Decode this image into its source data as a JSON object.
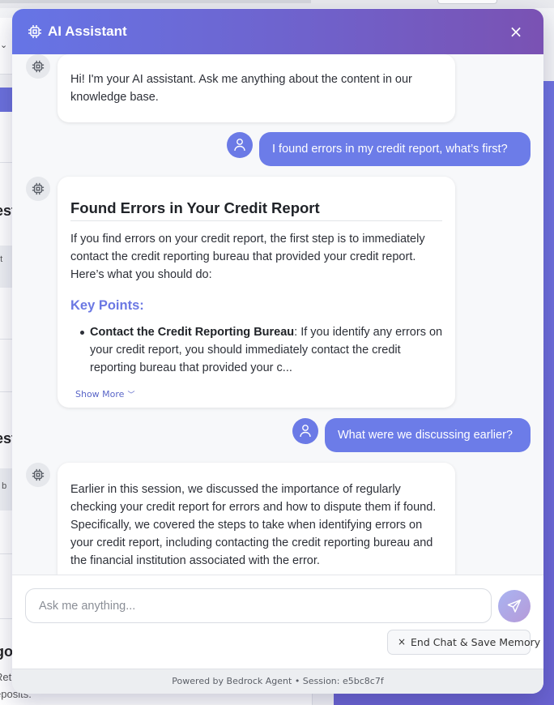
{
  "background": {
    "fragment_1": "est",
    "fragment_2": "nt",
    "fragment_3": "est",
    "fragment_4": "t b",
    "fragment_5": "go",
    "fragment_6": "Ret",
    "fragment_7": "eposits."
  },
  "header": {
    "title": "AI Assistant",
    "icon": "chip-icon",
    "close_glyph": "×"
  },
  "messages": [
    {
      "role": "assistant",
      "text": "Hi! I'm your AI assistant. Ask me anything about the content in our knowledge base."
    },
    {
      "role": "user",
      "text": "I found errors in my credit report, what’s first?"
    },
    {
      "role": "assistant",
      "title": "Found Errors in Your Credit Report",
      "intro": "If you find errors on your credit report, the first step is to immediately contact the credit reporting bureau that provided your credit report. Here’s what you should do:",
      "key_points_heading": "Key Points:",
      "key_points": [
        {
          "bold": "Contact the Credit Reporting Bureau",
          "text": ": If you identify any errors on your credit report, you should immediately contact the credit reporting bureau that provided your c..."
        }
      ],
      "show_more": "Show More"
    },
    {
      "role": "user",
      "text": "What were we discussing earlier?"
    },
    {
      "role": "assistant",
      "text": "Earlier in this session, we discussed the importance of regularly checking your credit report for errors and how to dispute them if found. Specifically, we covered the steps to take when identifying errors on your credit report, including contacting the credit reporting bureau and the financial institution associated with the error."
    }
  ],
  "input": {
    "placeholder": "Ask me anything...",
    "value": ""
  },
  "end_chat_label": "End Chat & Save Memory",
  "footer": "Powered by Bedrock Agent • Session: e5bc8c7f",
  "colors": {
    "accent": "#6c7ce8",
    "header_start": "#6675e6",
    "header_end": "#7a52b3",
    "key_points_heading": "#6b78e3"
  }
}
